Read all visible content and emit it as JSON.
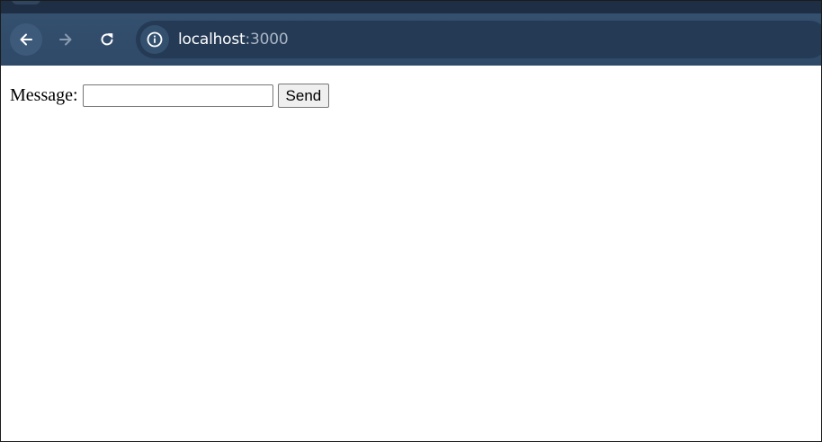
{
  "browser": {
    "url_host": "localhost",
    "url_port": ":3000",
    "icons": {
      "back": "arrow-left-icon",
      "forward": "arrow-right-icon",
      "reload": "reload-icon",
      "site_info": "info-icon"
    }
  },
  "page": {
    "message_label": "Message:",
    "message_value": "",
    "send_label": "Send"
  },
  "colors": {
    "toolbar": "#34506f",
    "omnibox": "#253a54",
    "tabstrip": "#1e2f45"
  }
}
